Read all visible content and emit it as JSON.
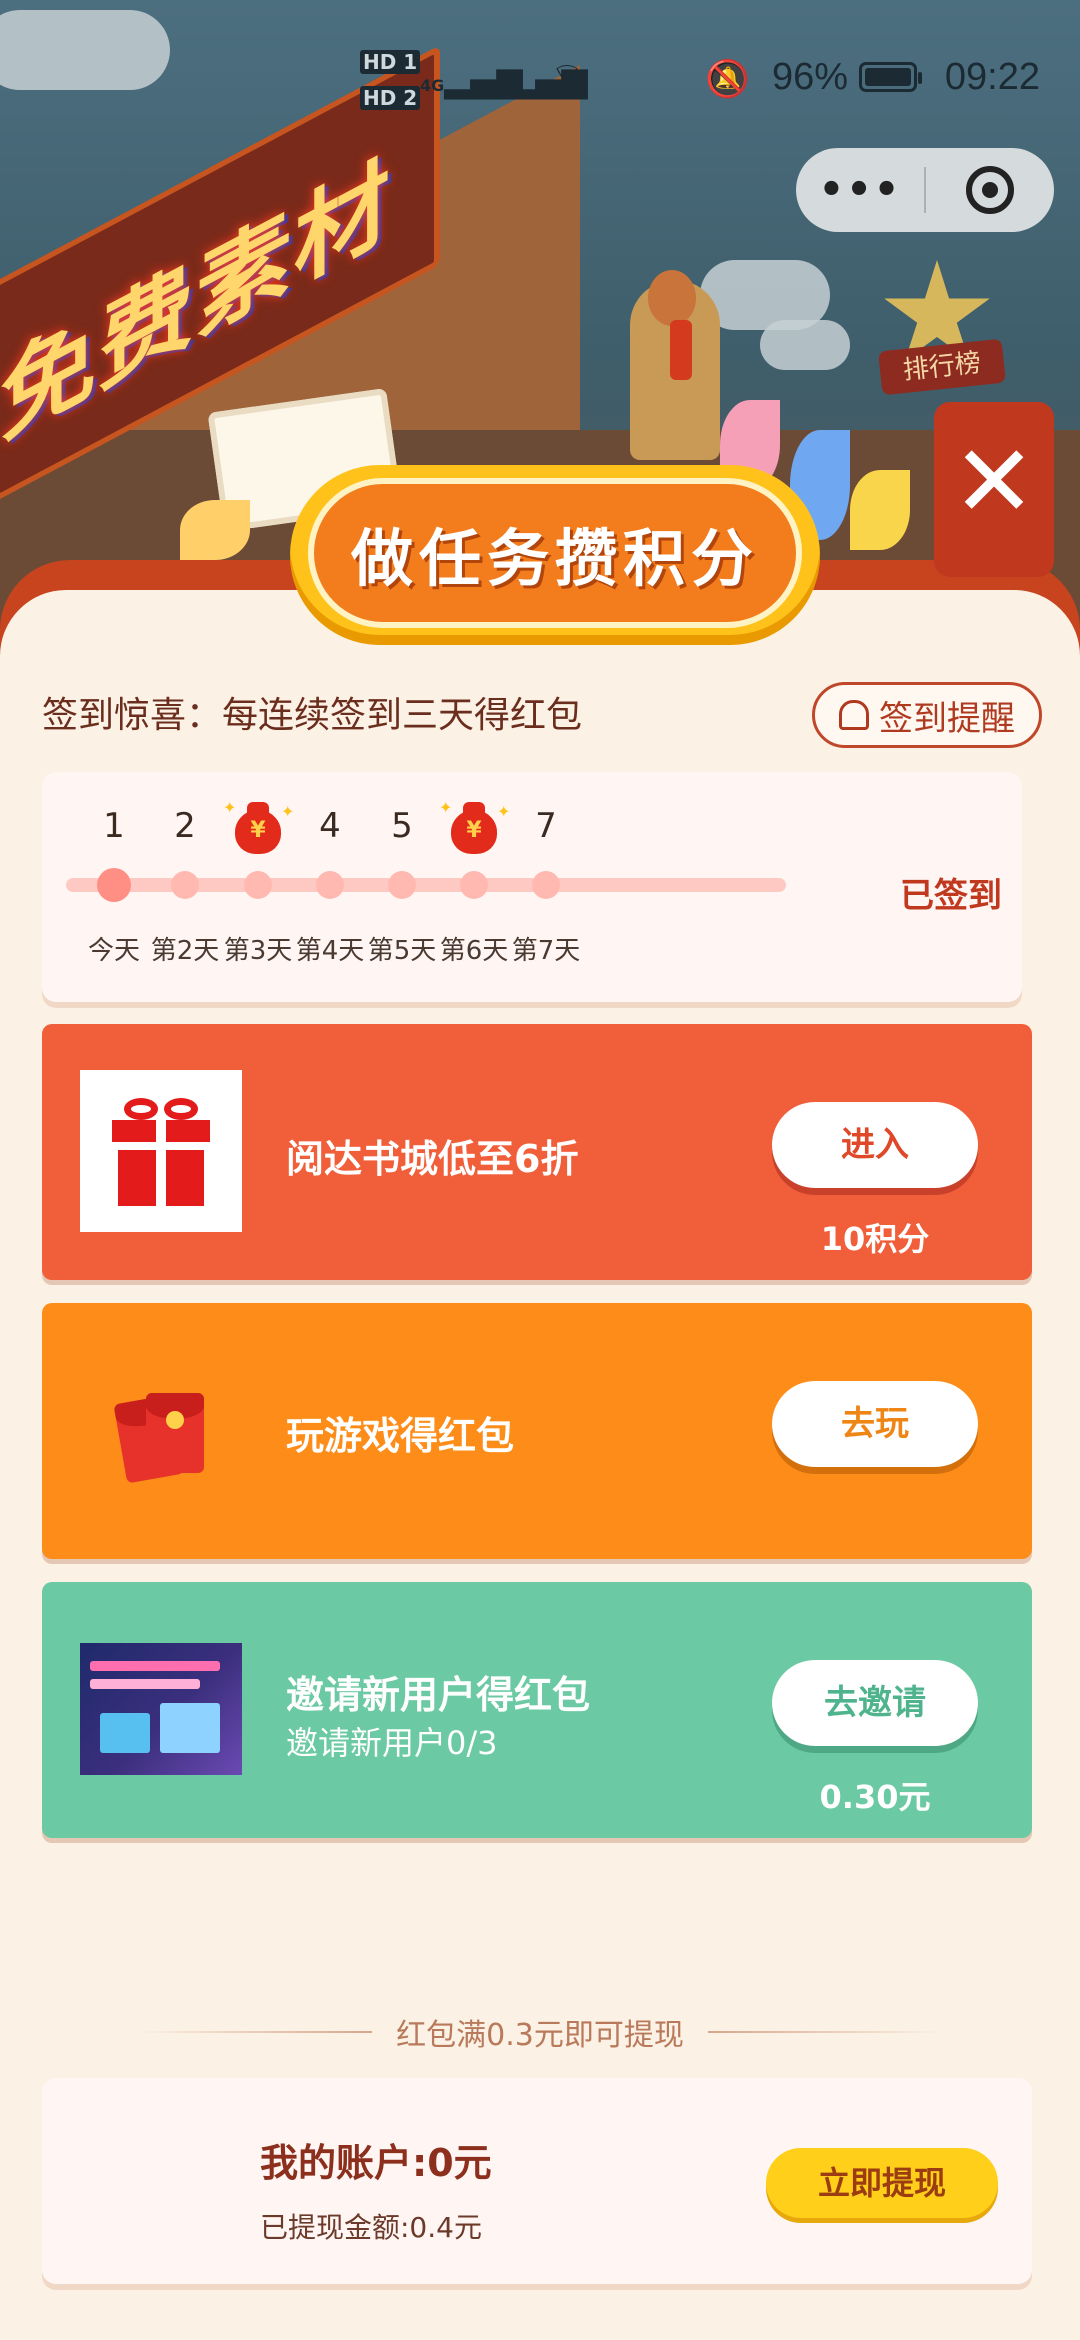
{
  "status_bar": {
    "hd1": "HD 1",
    "hd2": "HD 2",
    "signal1": "4G",
    "signal2": "4G",
    "battery_pct": "96%",
    "time": "09:22"
  },
  "capsule": {
    "more_icon": "more-dots-icon",
    "close_icon": "target-close-icon"
  },
  "background": {
    "sign_text": "免费素材",
    "ranking_label": "排行榜"
  },
  "banner": {
    "title": "做任务攒积分"
  },
  "signin": {
    "title": "签到惊喜：每连续签到三天得红包",
    "remind_label": "签到提醒",
    "status": "已签到",
    "days": [
      {
        "num": "1",
        "label": "今天",
        "reward": false,
        "active": true
      },
      {
        "num": "2",
        "label": "第2天",
        "reward": false,
        "active": false
      },
      {
        "num": "",
        "label": "第3天",
        "reward": true,
        "active": false
      },
      {
        "num": "4",
        "label": "第4天",
        "reward": false,
        "active": false
      },
      {
        "num": "5",
        "label": "第5天",
        "reward": false,
        "active": false
      },
      {
        "num": "",
        "label": "第6天",
        "reward": true,
        "active": false
      },
      {
        "num": "7",
        "label": "第7天",
        "reward": false,
        "active": false
      }
    ],
    "reward_symbol": "¥"
  },
  "tasks": [
    {
      "title": "阅达书城低至6折",
      "subtitle": "",
      "button": "进入",
      "reward": "10积分",
      "icon": "gift-icon",
      "color": "#f15e3a"
    },
    {
      "title": "玩游戏得红包",
      "subtitle": "",
      "button": "去玩",
      "reward": "",
      "icon": "red-packet-icon",
      "color": "#fd8c19"
    },
    {
      "title": "邀请新用户得红包",
      "subtitle": "邀请新用户0/3",
      "button": "去邀请",
      "reward": "0.30元",
      "icon": "poster-thumbnail",
      "color": "#6bc9a3"
    }
  ],
  "withdraw_note": "红包满0.3元即可提现",
  "account": {
    "title": "我的账户:0元",
    "withdrawn": "已提现金额:0.4元",
    "button": "立即提现"
  }
}
